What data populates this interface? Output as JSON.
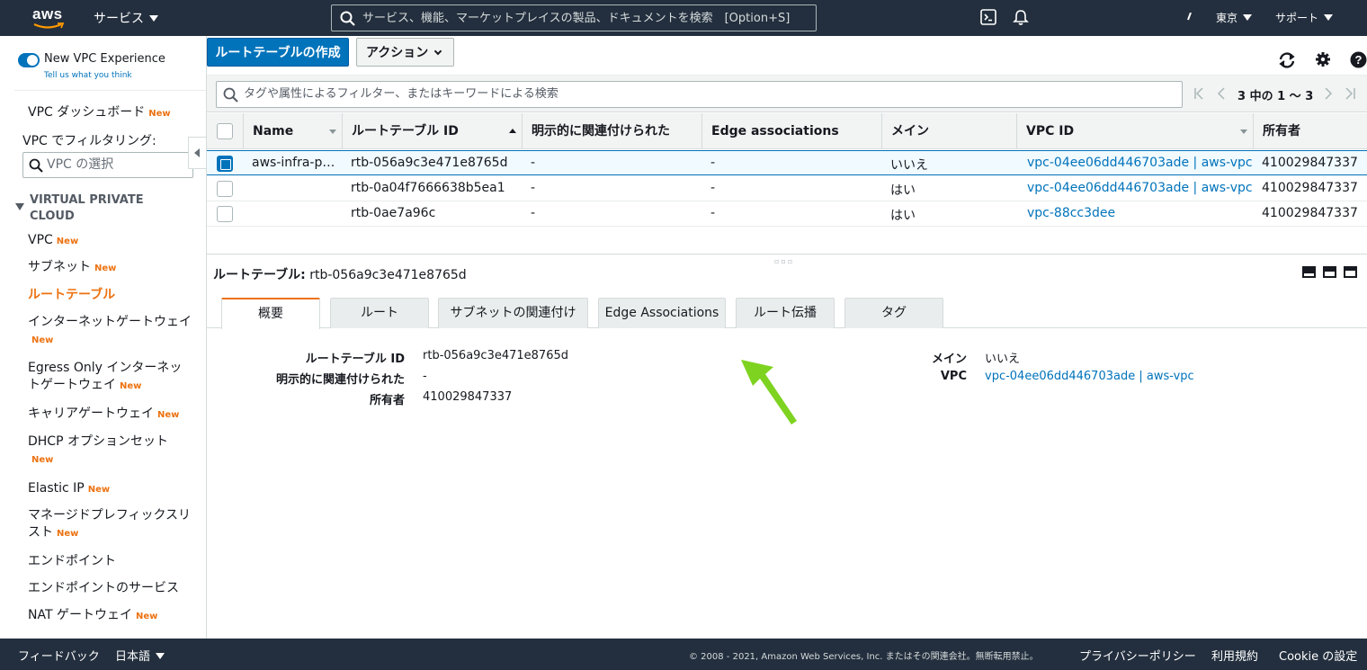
{
  "topnav": {
    "logo": "aws",
    "services_label": "サービス",
    "search_placeholder": "サービス、機能、マーケットプレイスの製品、ドキュメントを検索　[Option+S]",
    "region_label": "東京",
    "support_label": "サポート",
    "icons": [
      "terminal-icon",
      "bell-icon",
      "account-icon"
    ]
  },
  "sidebar": {
    "toggle_label": "New VPC Experience",
    "tell_us": "Tell us what you think",
    "dashboard": "VPC ダッシュボード",
    "filter_label": "VPC でフィルタリング:",
    "filter_placeholder": "VPC の選択",
    "section_title_1": "VIRTUAL PRIVATE",
    "section_title_2": "CLOUD",
    "new_badge": "New",
    "items": [
      {
        "label": "VPC",
        "new": true
      },
      {
        "label": "サブネット",
        "new": true
      },
      {
        "label": "ルートテーブル",
        "new": false
      },
      {
        "label": "インターネットゲートウェイ",
        "new": true
      },
      {
        "label": "Egress Only インターネットゲートウェイ",
        "new": true
      },
      {
        "label": "キャリアゲートウェイ",
        "new": true
      },
      {
        "label": "DHCP オプションセット",
        "new": true
      },
      {
        "label": "Elastic IP",
        "new": true
      },
      {
        "label": "マネージドプレフィックスリスト",
        "new": true
      },
      {
        "label": "エンドポイント",
        "new": false
      },
      {
        "label": "エンドポイントのサービス",
        "new": false
      },
      {
        "label": "NAT ゲートウェイ",
        "new": true
      }
    ]
  },
  "toolbar": {
    "create_label": "ルートテーブルの作成",
    "actions_label": "アクション"
  },
  "filter": {
    "placeholder": "タグや属性によるフィルター、またはキーワードによる検索",
    "pager": "3 中の 1 ～ 3"
  },
  "table": {
    "columns": [
      "Name",
      "ルートテーブル ID",
      "明示的に関連付けられた",
      "Edge associations",
      "メイン",
      "VPC ID",
      "所有者"
    ],
    "rows": [
      {
        "name": "aws-infra-p…",
        "id": "rtb-056a9c3e471e8765d",
        "explicit": "-",
        "edge": "-",
        "main": "いいえ",
        "vpc": "vpc-04ee06dd446703ade | aws-vpc",
        "owner": "410029847337",
        "selected": true
      },
      {
        "name": "",
        "id": "rtb-0a04f7666638b5ea1",
        "explicit": "-",
        "edge": "-",
        "main": "はい",
        "vpc": "vpc-04ee06dd446703ade | aws-vpc",
        "owner": "410029847337",
        "selected": false
      },
      {
        "name": "",
        "id": "rtb-0ae7a96c",
        "explicit": "-",
        "edge": "-",
        "main": "はい",
        "vpc": "vpc-88cc3dee",
        "owner": "410029847337",
        "selected": false
      }
    ]
  },
  "detail": {
    "title_label": "ルートテーブル:",
    "title_value": "rtb-056a9c3e471e8765d",
    "tabs": [
      "概要",
      "ルート",
      "サブネットの関連付け",
      "Edge Associations",
      "ルート伝播",
      "タグ"
    ],
    "left": [
      {
        "label": "ルートテーブル ID",
        "value": "rtb-056a9c3e471e8765d"
      },
      {
        "label": "明示的に関連付けられた",
        "value": "-"
      },
      {
        "label": "所有者",
        "value": "410029847337"
      }
    ],
    "right": [
      {
        "label": "メイン",
        "value": "いいえ"
      },
      {
        "label": "VPC",
        "value": "vpc-04ee06dd446703ade | aws-vpc"
      }
    ]
  },
  "footer": {
    "feedback": "フィードバック",
    "language": "日本語",
    "copyright": "© 2008 - 2021, Amazon Web Services, Inc. またはその関連会社。無断転用禁止。",
    "privacy": "プライバシーポリシー",
    "terms": "利用規約",
    "cookie": "Cookie の設定"
  },
  "colors": {
    "nav_bg": "#232f3e",
    "primary": "#0073bb",
    "accent": "#ec7211",
    "arrow": "#7ed321"
  }
}
